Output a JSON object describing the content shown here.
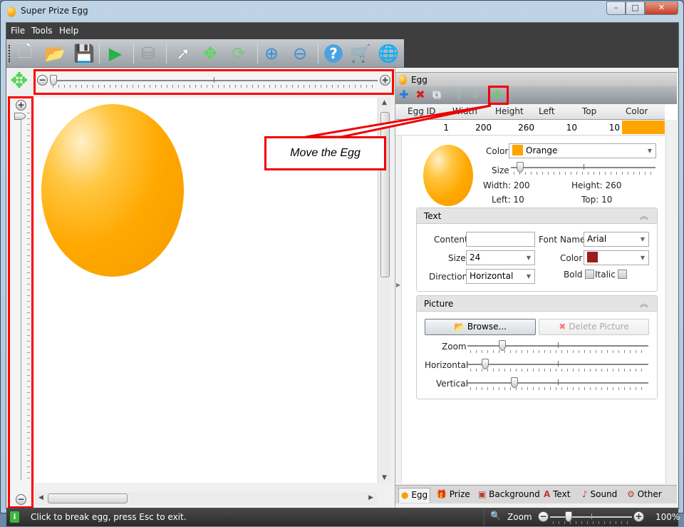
{
  "window": {
    "title": "Super Prize Egg",
    "minimize": "–",
    "maximize": "□",
    "close": "✕"
  },
  "menu": [
    "File",
    "Tools",
    "Help"
  ],
  "toolbar": [
    {
      "name": "new-icon",
      "glyph": "🗋"
    },
    {
      "name": "open-icon",
      "glyph": "📂"
    },
    {
      "name": "save-icon",
      "glyph": "💾"
    },
    {
      "name": "play-icon",
      "glyph": "▶"
    },
    {
      "name": "database-icon",
      "glyph": "⛁"
    },
    {
      "name": "pointer-icon",
      "glyph": "➚"
    },
    {
      "name": "move-icon",
      "glyph": "✥"
    },
    {
      "name": "refresh-icon",
      "glyph": "⟳"
    },
    {
      "name": "zoom-in-icon",
      "glyph": "⊕"
    },
    {
      "name": "zoom-out-icon",
      "glyph": "⊖"
    },
    {
      "name": "help-icon",
      "glyph": "?"
    },
    {
      "name": "cart-icon",
      "glyph": "🛒"
    },
    {
      "name": "globe-icon",
      "glyph": "🌐"
    }
  ],
  "canvas": {
    "move_glyph": "✥",
    "zoom_plus": "+",
    "zoom_minus": "−"
  },
  "callout": {
    "text": "Move the Egg"
  },
  "egg_panel": {
    "title": "Egg",
    "toolbar": {
      "add": "✚",
      "delete": "✖",
      "copy": "⧉",
      "up": "⇧",
      "down": "⇩",
      "move": "✥"
    },
    "grid": {
      "columns": [
        "Egg ID",
        "Width",
        "Height",
        "Left",
        "Top",
        "Color"
      ],
      "rows": [
        {
          "id": "1",
          "width": "200",
          "height": "260",
          "left": "10",
          "top": "10",
          "color": "#FFA500"
        }
      ]
    },
    "details": {
      "color_label": "Color",
      "color_value": "Orange",
      "color_hex": "#FFA500",
      "size_label": "Size",
      "size_value": 0.04,
      "width": "Width: 200",
      "height": "Height: 260",
      "left": "Left: 10",
      "top": "Top: 10"
    }
  },
  "text_group": {
    "title": "Text",
    "content_label": "Content",
    "content_value": "",
    "font_label": "Font Name",
    "font_value": "Arial",
    "size_label": "Size",
    "size_value": "24",
    "color_label": "Color",
    "color_value": "#FF93232C",
    "color_hex": "#9B1C1C",
    "direction_label": "Direction",
    "direction_value": "Horizontal",
    "bold_label": "Bold",
    "italic_label": "Italic"
  },
  "picture_group": {
    "title": "Picture",
    "browse": "Browse...",
    "delete": "Delete Picture",
    "zoom_label": "Zoom",
    "zoom_value": 0.18,
    "horizontal_label": "Horizontal",
    "horizontal_value": 0.08,
    "vertical_label": "Vertical",
    "vertical_value": 0.25
  },
  "tabs": [
    {
      "label": "Egg",
      "icon": "egg-icon",
      "glyph": "●",
      "color": "#f5a000"
    },
    {
      "label": "Prize",
      "icon": "gift-icon",
      "glyph": "🎁",
      "color": "#c0392b"
    },
    {
      "label": "Background",
      "icon": "picture-icon",
      "glyph": "▣",
      "color": "#c0392b"
    },
    {
      "label": "Text",
      "icon": "text-icon",
      "glyph": "A",
      "color": "#c0392b"
    },
    {
      "label": "Sound",
      "icon": "music-icon",
      "glyph": "♪",
      "color": "#c0392b"
    },
    {
      "label": "Other",
      "icon": "gear-icon",
      "glyph": "⚙",
      "color": "#c0392b"
    }
  ],
  "status": {
    "text": "Click to break egg, press Esc to exit.",
    "zoom_label": "Zoom",
    "zoom_percent": "100%",
    "zoom_value": 0.2
  }
}
